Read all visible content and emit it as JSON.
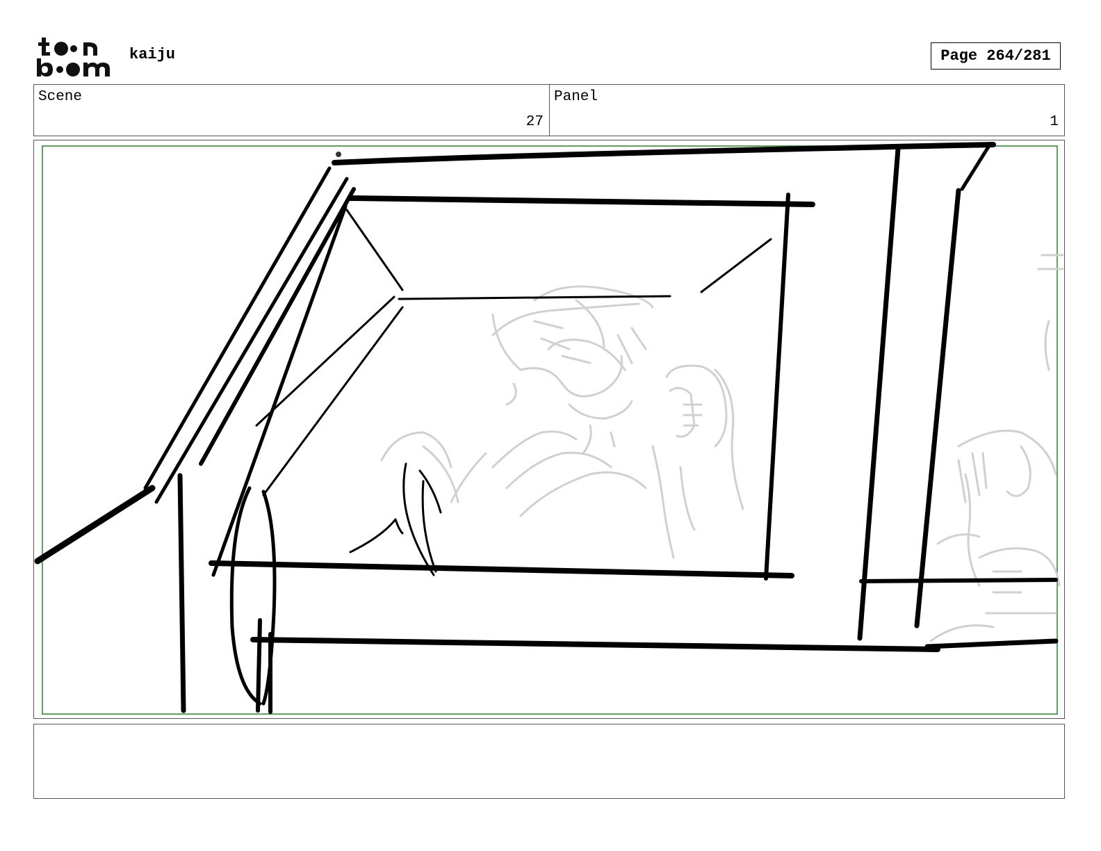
{
  "header": {
    "logo_text_top": "toon",
    "logo_text_bottom": "boom",
    "project_name": "kaiju",
    "page_label": "Page 264/281"
  },
  "info": {
    "scene_label": "Scene",
    "scene_value": "27",
    "panel_label": "Panel",
    "panel_value": "1"
  },
  "frame": {
    "safe_area_color": "#2e7d32",
    "ink_color": "#000000",
    "rough_color": "#cfcfcf"
  },
  "notes": {
    "text": ""
  }
}
